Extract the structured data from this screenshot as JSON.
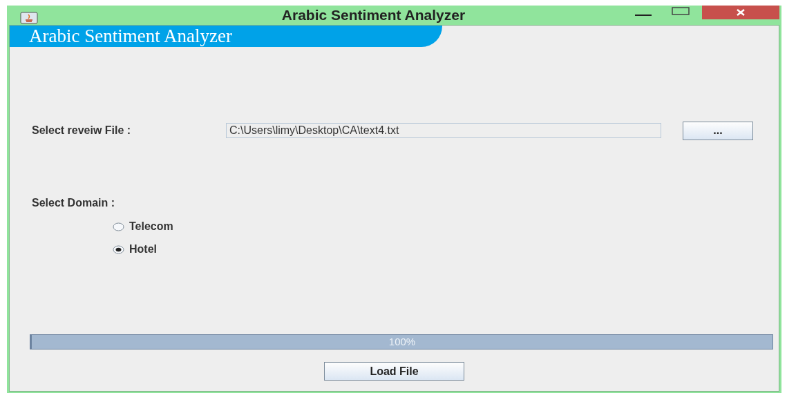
{
  "window": {
    "title": "Arabic Sentiment Analyzer"
  },
  "banner": {
    "title": "Arabic Sentiment Analyzer"
  },
  "file": {
    "label": "Select reveiw File :",
    "value": "C:\\Users\\limy\\Desktop\\CA\\text4.txt",
    "browse_button": "..."
  },
  "domain": {
    "label": "Select Domain :",
    "options": [
      {
        "label": "Telecom",
        "selected": false
      },
      {
        "label": "Hotel",
        "selected": true
      }
    ]
  },
  "progress": {
    "level": 1.0,
    "reading": "100%"
  },
  "buttons": [
    "Load File"
  ]
}
